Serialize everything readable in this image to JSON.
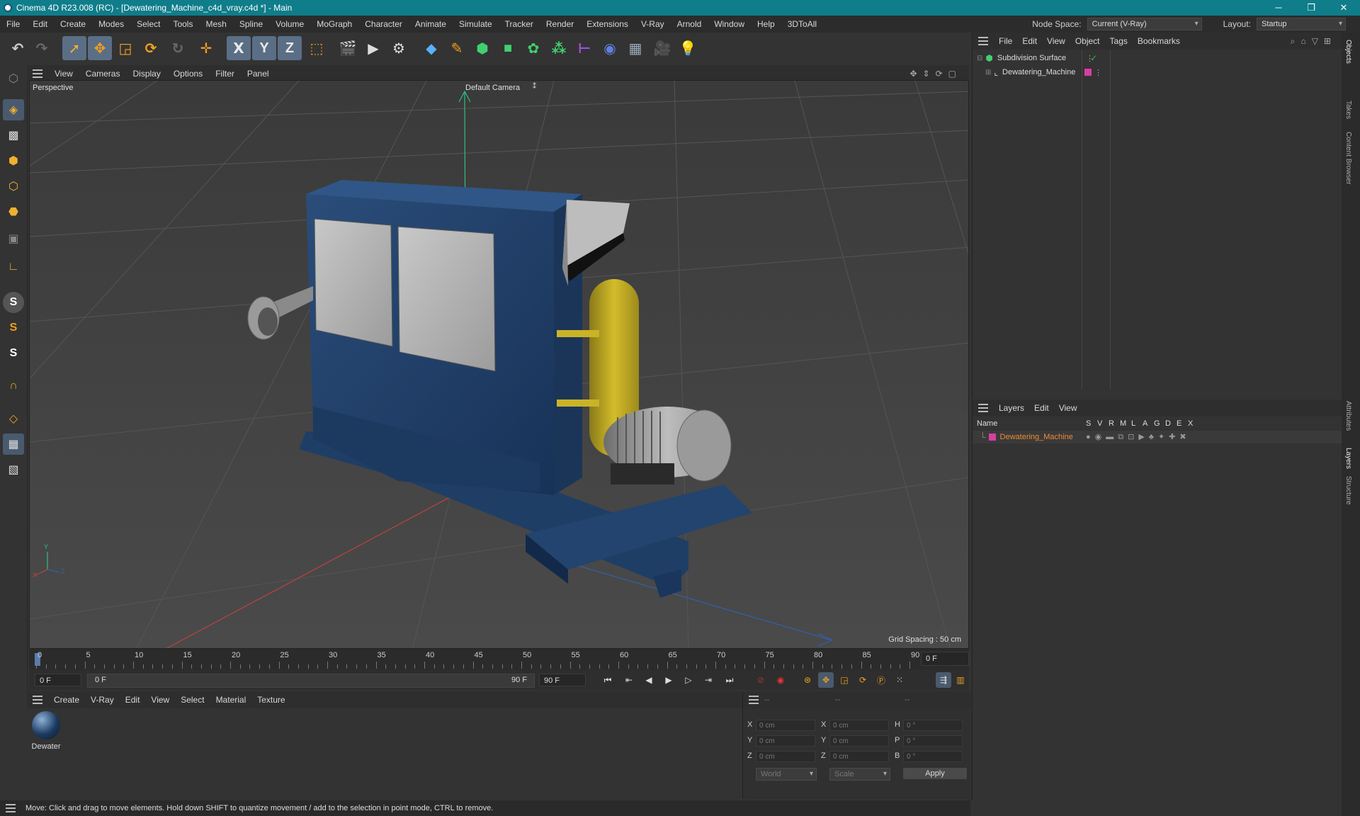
{
  "window": {
    "title": "Cinema 4D R23.008 (RC) - [Dewatering_Machine_c4d_vray.c4d *] - Main",
    "minimize": "─",
    "restore": "❐",
    "close": "✕"
  },
  "menubar": {
    "items": [
      "File",
      "Edit",
      "Create",
      "Modes",
      "Select",
      "Tools",
      "Mesh",
      "Spline",
      "Volume",
      "MoGraph",
      "Character",
      "Animate",
      "Simulate",
      "Tracker",
      "Render",
      "Extensions",
      "V-Ray",
      "Arnold",
      "Window",
      "Help",
      "3DToAll"
    ],
    "node_space_label": "Node Space:",
    "node_space_value": "Current (V-Ray)",
    "layout_label": "Layout:",
    "layout_value": "Startup"
  },
  "toolbar": {
    "axis_x": "X",
    "axis_y": "Y",
    "axis_z": "Z"
  },
  "left_tools": {
    "s1": "S",
    "s2": "S",
    "s3": "S"
  },
  "viewport": {
    "menu": [
      "View",
      "Cameras",
      "Display",
      "Options",
      "Filter",
      "Panel"
    ],
    "perspective_label": "Perspective",
    "camera_label": "Default Camera",
    "grid_spacing": "Grid Spacing : 50 cm",
    "axis_x": "X",
    "axis_y": "Y",
    "axis_z": "Z"
  },
  "timeline": {
    "ticks": [
      "0",
      "5",
      "10",
      "15",
      "20",
      "25",
      "30",
      "35",
      "40",
      "45",
      "50",
      "55",
      "60",
      "65",
      "70",
      "75",
      "80",
      "85",
      "90"
    ],
    "current_frame": "0 F",
    "start_frame": "0 F",
    "range_start": "0 F",
    "range_end": "90 F",
    "end_frame": "90 F"
  },
  "material_manager": {
    "menu": [
      "Create",
      "V-Ray",
      "Edit",
      "View",
      "Select",
      "Material",
      "Texture"
    ],
    "materials": [
      {
        "name": "Dewater"
      }
    ]
  },
  "coordinates": {
    "headers": [
      "--",
      "--",
      "--"
    ],
    "rows": [
      {
        "l1": "X",
        "v1": "0 cm",
        "l2": "X",
        "v2": "0 cm",
        "l3": "H",
        "v3": "0 °"
      },
      {
        "l1": "Y",
        "v1": "0 cm",
        "l2": "Y",
        "v2": "0 cm",
        "l3": "P",
        "v3": "0 °"
      },
      {
        "l1": "Z",
        "v1": "0 cm",
        "l2": "Z",
        "v2": "0 cm",
        "l3": "B",
        "v3": "0 °"
      }
    ],
    "space": "World",
    "mode": "Scale",
    "apply": "Apply"
  },
  "status": {
    "text": "Move: Click and drag to move elements. Hold down SHIFT to quantize movement / add to the selection in point mode, CTRL to remove."
  },
  "objects_panel": {
    "menu": [
      "File",
      "Edit",
      "View",
      "Object",
      "Tags",
      "Bookmarks"
    ],
    "items": [
      {
        "name": "Subdivision Surface"
      },
      {
        "name": "Dewatering_Machine"
      }
    ]
  },
  "layers_panel": {
    "menu": [
      "Layers",
      "Edit",
      "View"
    ],
    "columns": [
      "Name",
      "S",
      "V",
      "R",
      "M",
      "L",
      "A",
      "G",
      "D",
      "E",
      "X"
    ],
    "layers": [
      {
        "name": "Dewatering_Machine",
        "color": "#d63fa0"
      }
    ]
  },
  "side_tabs": [
    "Objects",
    "Takes",
    "Content Browser",
    "Attributes",
    "Layers",
    "Structure"
  ],
  "colors": {
    "title_bar": "#0f7d8a",
    "selection_blue": "#5a6e86",
    "layer_name_orange": "#f08a30",
    "layer_color": "#d63fa0"
  }
}
